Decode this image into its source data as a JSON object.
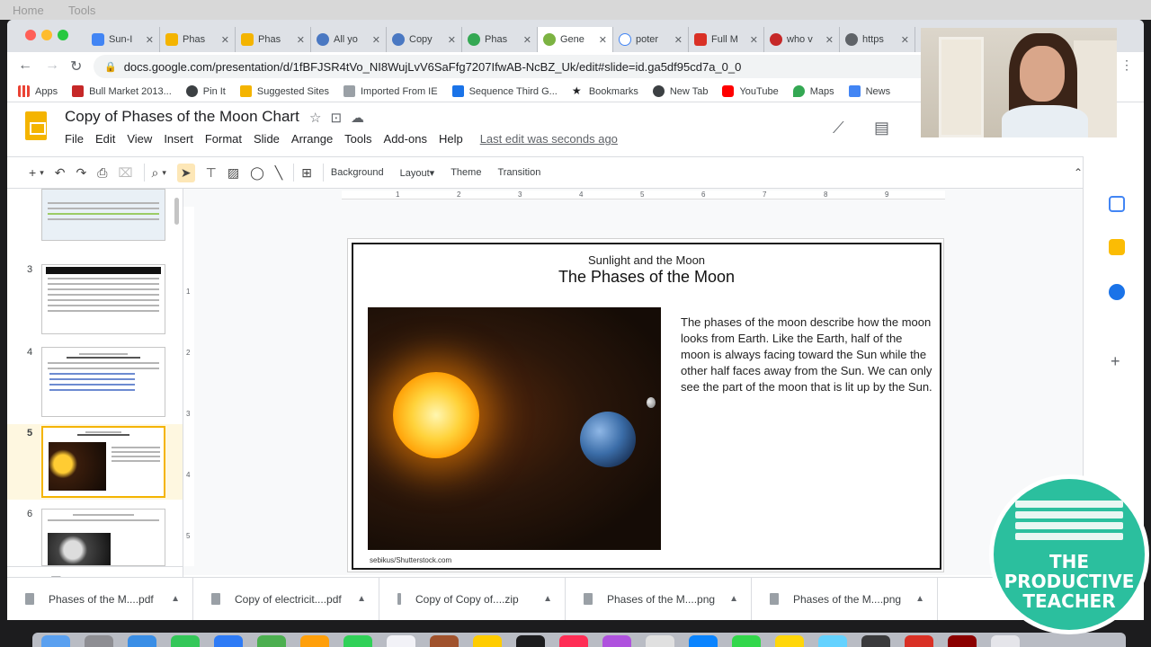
{
  "mac_menu": {
    "ghost_left": "Home",
    "ghost_right": "Tools"
  },
  "tabs": [
    {
      "label": "Sun-I",
      "color": "#4285f4"
    },
    {
      "label": "Phas",
      "color": "#f4b400"
    },
    {
      "label": "Phas",
      "color": "#f4b400"
    },
    {
      "label": "All yo",
      "color": "#4a78c2"
    },
    {
      "label": "Copy",
      "color": "#4a78c2"
    },
    {
      "label": "Phas",
      "color": "#34a853"
    },
    {
      "label": "Gene",
      "color": "#7cb342"
    },
    {
      "label": "poter",
      "color": "#4285f4"
    },
    {
      "label": "Full M",
      "color": "#d93025"
    },
    {
      "label": "who v",
      "color": "#c62828"
    },
    {
      "label": "https",
      "color": "#5f6368"
    }
  ],
  "address": {
    "url": "docs.google.com/presentation/d/1fBFJSR4tVo_NI8WujLvV6SaFfg7207IfwAB-NcBZ_Uk/edit#slide=id.ga5df95cd7a_0_0"
  },
  "bookmarks": [
    {
      "label": "Apps",
      "color": "#ea4335"
    },
    {
      "label": "Bull Market 2013...",
      "color": "#c62828"
    },
    {
      "label": "Pin It",
      "color": "#3c4043"
    },
    {
      "label": "Suggested Sites",
      "color": "#f4b400"
    },
    {
      "label": "Imported From IE",
      "color": "#9aa0a6"
    },
    {
      "label": "Sequence Third G...",
      "color": "#1a73e8"
    },
    {
      "label": "Bookmarks",
      "color": "#202124"
    },
    {
      "label": "New Tab",
      "color": "#3c4043"
    },
    {
      "label": "YouTube",
      "color": "#ff0000"
    },
    {
      "label": "Maps",
      "color": "#34a853"
    },
    {
      "label": "News",
      "color": "#4285f4"
    }
  ],
  "doc": {
    "title": "Copy of Phases of the Moon Chart"
  },
  "menu": [
    "File",
    "Edit",
    "View",
    "Insert",
    "Format",
    "Slide",
    "Arrange",
    "Tools",
    "Add-ons",
    "Help"
  ],
  "last_edit": "Last edit was seconds ago",
  "toolbar": {
    "background": "Background",
    "layout": "Layout",
    "theme": "Theme",
    "transition": "Transition"
  },
  "filmstrip": {
    "numbers": [
      "3",
      "4",
      "5",
      "6"
    ],
    "selected": "5"
  },
  "slide": {
    "subtitle": "Sunlight and the Moon",
    "title": "The Phases of the Moon",
    "body": "The phases of the moon describe how the moon looks from Earth. Like the Earth, half of the moon is always facing toward the Sun while the other half faces away from the Sun. We can only see the part of the moon that is lit up by the Sun.",
    "credit": "sebikus/Shutterstock.com"
  },
  "ruler": {
    "top": [
      "1",
      "2",
      "3",
      "4",
      "5",
      "6",
      "7",
      "8",
      "9"
    ],
    "left": [
      "1",
      "2",
      "3",
      "4",
      "5"
    ]
  },
  "downloads": [
    {
      "name": "Phases of the M....pdf"
    },
    {
      "name": "Copy of electricit....pdf"
    },
    {
      "name": "Copy of Copy of....zip"
    },
    {
      "name": "Phases of the M....png"
    },
    {
      "name": "Phases of the M....png"
    }
  ],
  "badge": {
    "line1": "THE",
    "line2": "PRODUCTIVE",
    "line3": "TEACHER"
  },
  "colors": {
    "accent": "#f4b400",
    "badge": "#2bbf9e"
  }
}
